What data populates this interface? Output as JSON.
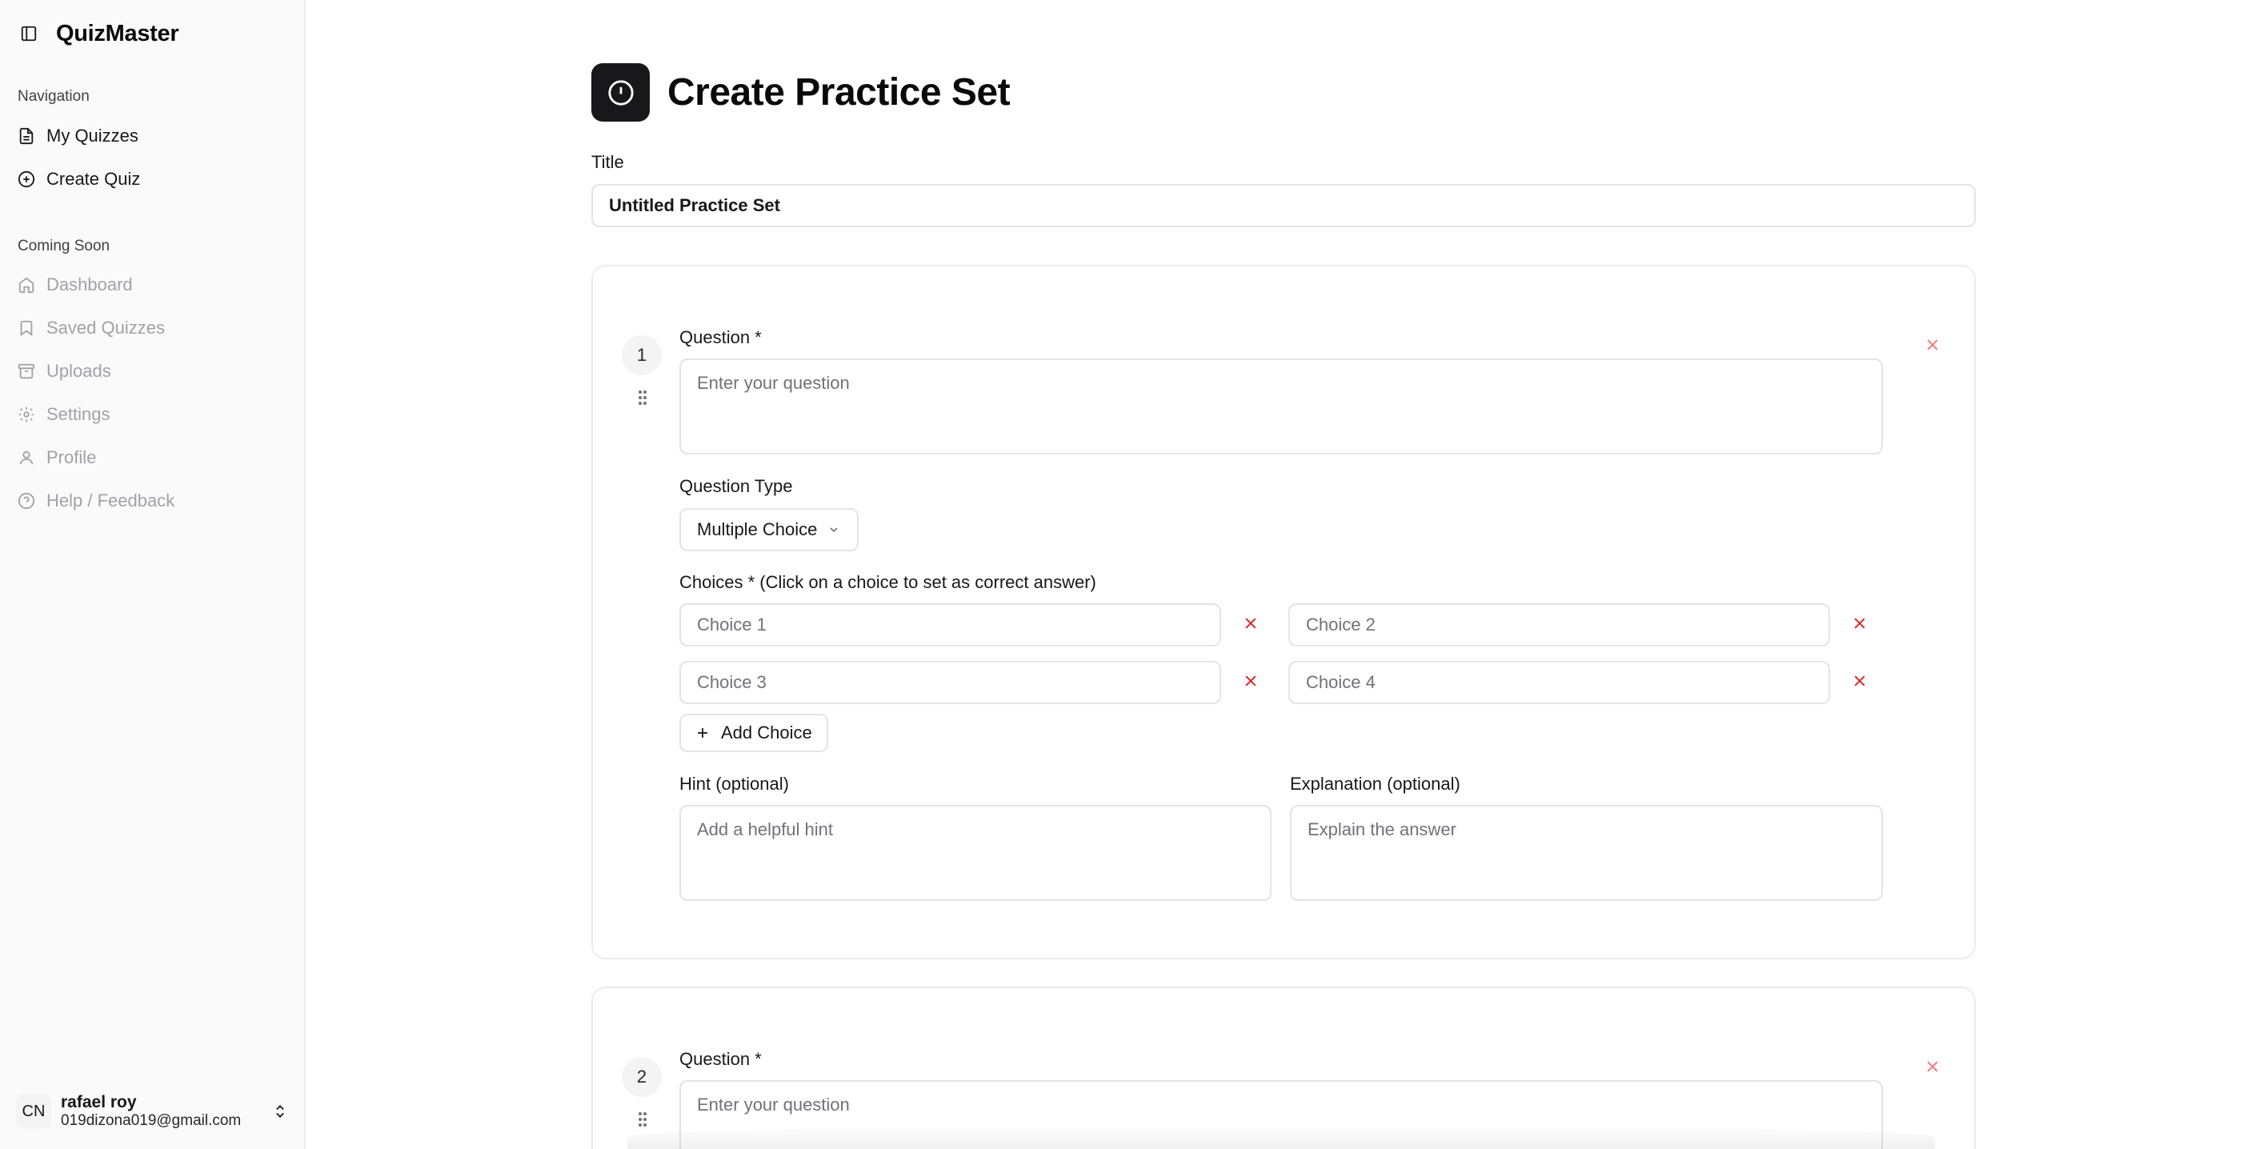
{
  "sidebar": {
    "app_title": "QuizMaster",
    "navigation_label": "Navigation",
    "nav_items": [
      {
        "label": "My Quizzes",
        "icon": "document-icon"
      },
      {
        "label": "Create Quiz",
        "icon": "plus-circle-icon"
      }
    ],
    "coming_soon_label": "Coming Soon",
    "coming_soon_items": [
      {
        "label": "Dashboard",
        "icon": "home-icon"
      },
      {
        "label": "Saved Quizzes",
        "icon": "bookmark-icon"
      },
      {
        "label": "Uploads",
        "icon": "archive-icon"
      },
      {
        "label": "Settings",
        "icon": "gear-icon"
      },
      {
        "label": "Profile",
        "icon": "user-icon"
      },
      {
        "label": "Help / Feedback",
        "icon": "help-circle-icon"
      }
    ],
    "user": {
      "initials": "CN",
      "name": "rafael roy",
      "email": "019dizona019@gmail.com"
    }
  },
  "main": {
    "page_title": "Create Practice Set",
    "title_label": "Title",
    "title_value": "Untitled Practice Set",
    "questions": [
      {
        "number": "1",
        "question_label": "Question *",
        "question_placeholder": "Enter your question",
        "type_label": "Question Type",
        "type_value": "Multiple Choice",
        "choices_label": "Choices * (Click on a choice to set as correct answer)",
        "choices": [
          "Choice 1",
          "Choice 2",
          "Choice 3",
          "Choice 4"
        ],
        "add_choice_label": "Add Choice",
        "hint_label": "Hint (optional)",
        "hint_placeholder": "Add a helpful hint",
        "explanation_label": "Explanation (optional)",
        "explanation_placeholder": "Explain the answer"
      },
      {
        "number": "2",
        "question_label": "Question *",
        "question_placeholder": "Enter your question"
      }
    ]
  },
  "colors": {
    "accent": "#18181b",
    "danger": "#dc2626",
    "muted": "#a1a1aa",
    "border": "#e4e4e7"
  }
}
